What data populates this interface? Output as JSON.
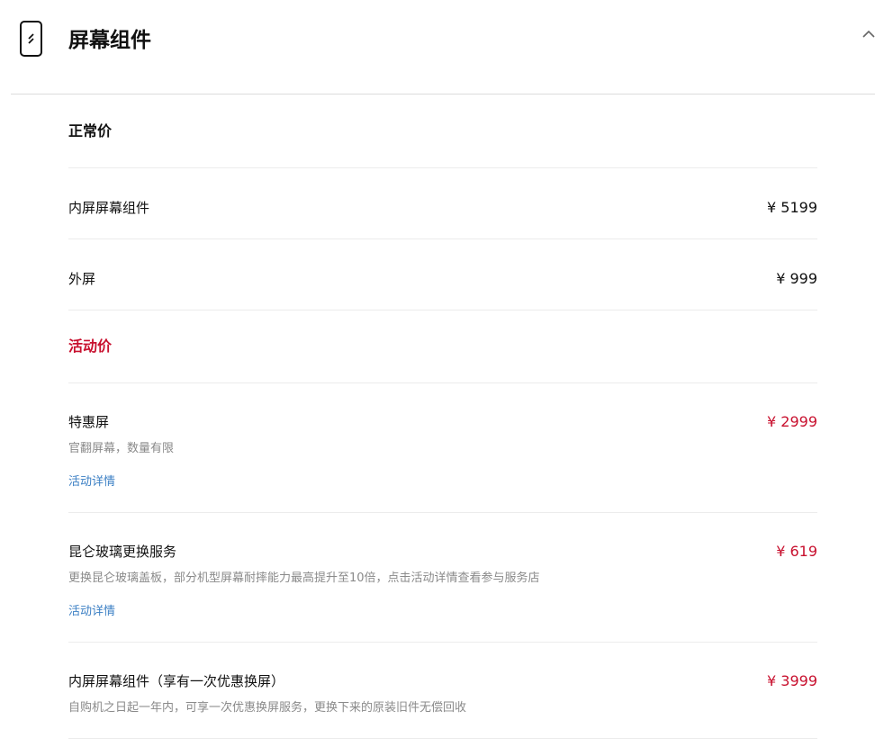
{
  "header": {
    "title": "屏幕组件",
    "icon": "phone-screen-icon",
    "collapse_icon": "chevron-up-icon"
  },
  "colors": {
    "accent_red": "#c8102e",
    "link_blue": "#3b7fc4"
  },
  "normal": {
    "label": "正常价",
    "items": [
      {
        "name": "内屏屏幕组件",
        "price": "¥ 5199"
      },
      {
        "name": "外屏",
        "price": "¥ 999"
      }
    ]
  },
  "promo": {
    "label": "活动价",
    "items": [
      {
        "name": "特惠屏",
        "price": "¥ 2999",
        "desc": "官翻屏幕，数量有限",
        "link": "活动详情"
      },
      {
        "name": "昆仑玻璃更换服务",
        "price": "¥ 619",
        "desc": "更换昆仑玻璃盖板，部分机型屏幕耐摔能力最高提升至10倍，点击活动详情查看参与服务店",
        "link": "活动详情"
      },
      {
        "name": "内屏屏幕组件（享有一次优惠换屏）",
        "price": "¥ 3999",
        "desc": "自购机之日起一年内，可享一次优惠换屏服务，更换下来的原装旧件无偿回收"
      }
    ]
  }
}
